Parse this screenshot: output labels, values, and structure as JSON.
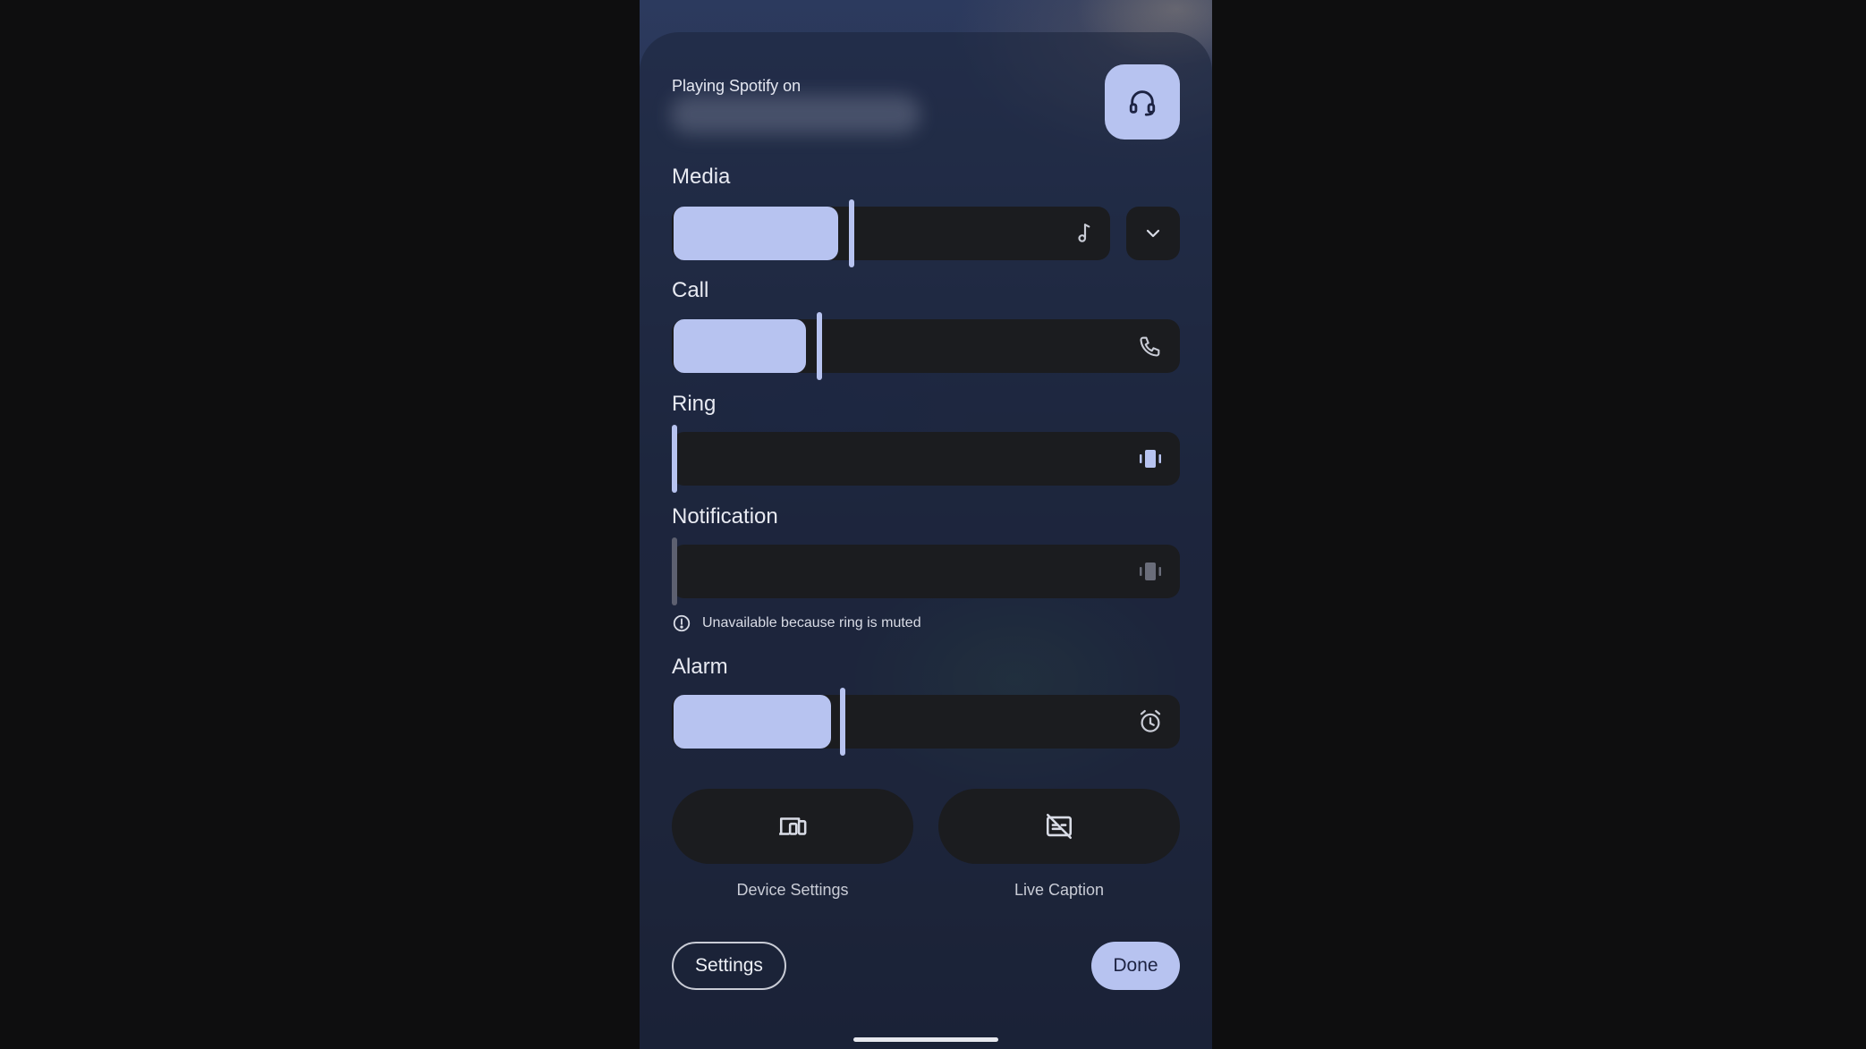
{
  "header": {
    "title": "Playing Spotify on",
    "output_icon": "headphones-icon"
  },
  "streams": [
    {
      "label": "Media",
      "level": 0.35,
      "icon": "music-note-icon"
    },
    {
      "label": "Call",
      "level": 0.3,
      "icon": "phone-icon"
    },
    {
      "label": "Ring",
      "level": 0.0,
      "icon": "vibrate-icon"
    },
    {
      "label": "Notification",
      "level": 0.0,
      "icon": "vibrate-icon",
      "disabled": true
    },
    {
      "label": "Alarm",
      "level": 0.34,
      "icon": "alarm-icon"
    }
  ],
  "notice": {
    "text": "Unavailable because ring is muted",
    "icon": "info-icon"
  },
  "quick_actions": [
    {
      "label": "Device Settings",
      "icon": "devices-icon"
    },
    {
      "label": "Live Caption",
      "icon": "live-caption-off-icon"
    }
  ],
  "footer": {
    "settings_label": "Settings",
    "done_label": "Done"
  },
  "colors": {
    "accent": "#b7c3f0",
    "track": "#1b1c1f",
    "background": "#0e0e0f"
  }
}
